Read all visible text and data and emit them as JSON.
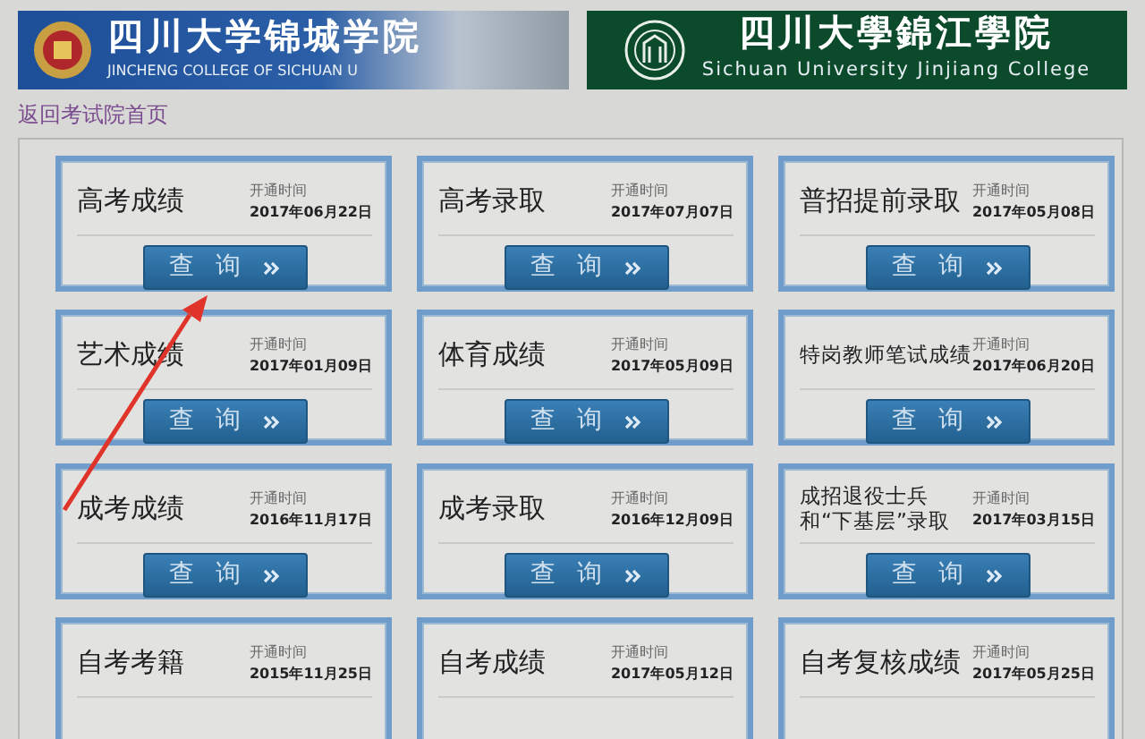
{
  "banners": {
    "left": {
      "title": "四川大学锦城学院",
      "subtitle": "JINCHENG COLLEGE OF SICHUAN U"
    },
    "right": {
      "title": "四川大學錦江學院",
      "subtitle": "Sichuan University Jinjiang College"
    }
  },
  "back_link": "返回考试院首页",
  "cards": [
    {
      "title": [
        "高考成绩"
      ],
      "time_label": "开通时间",
      "date": "2017年06月22日",
      "button": "查 询"
    },
    {
      "title": [
        "高考录取"
      ],
      "time_label": "开通时间",
      "date": "2017年07月07日",
      "button": "查 询"
    },
    {
      "title": [
        "普招提前录取"
      ],
      "time_label": "开通时间",
      "date": "2017年05月08日",
      "button": "查 询"
    },
    {
      "title": [
        "艺术成绩"
      ],
      "time_label": "开通时间",
      "date": "2017年01月09日",
      "button": "查 询"
    },
    {
      "title": [
        "体育成绩"
      ],
      "time_label": "开通时间",
      "date": "2017年05月09日",
      "button": "查 询"
    },
    {
      "title": [
        "特岗教师笔试成绩"
      ],
      "time_label": "开通时间",
      "date": "2017年06月20日",
      "button": "查 询"
    },
    {
      "title": [
        "成考成绩"
      ],
      "time_label": "开通时间",
      "date": "2016年11月17日",
      "button": "查 询"
    },
    {
      "title": [
        "成考录取"
      ],
      "time_label": "开通时间",
      "date": "2016年12月09日",
      "button": "查 询"
    },
    {
      "title": [
        "成招退役士兵",
        "和“下基层”录取"
      ],
      "time_label": "开通时间",
      "date": "2017年03月15日",
      "button": "查 询"
    },
    {
      "title": [
        "自考考籍"
      ],
      "time_label": "开通时间",
      "date": "2015年11月25日"
    },
    {
      "title": [
        "自考成绩"
      ],
      "time_label": "开通时间",
      "date": "2017年05月12日"
    },
    {
      "title": [
        "自考复核成绩"
      ],
      "time_label": "开通时间",
      "date": "2017年05月25日"
    }
  ]
}
